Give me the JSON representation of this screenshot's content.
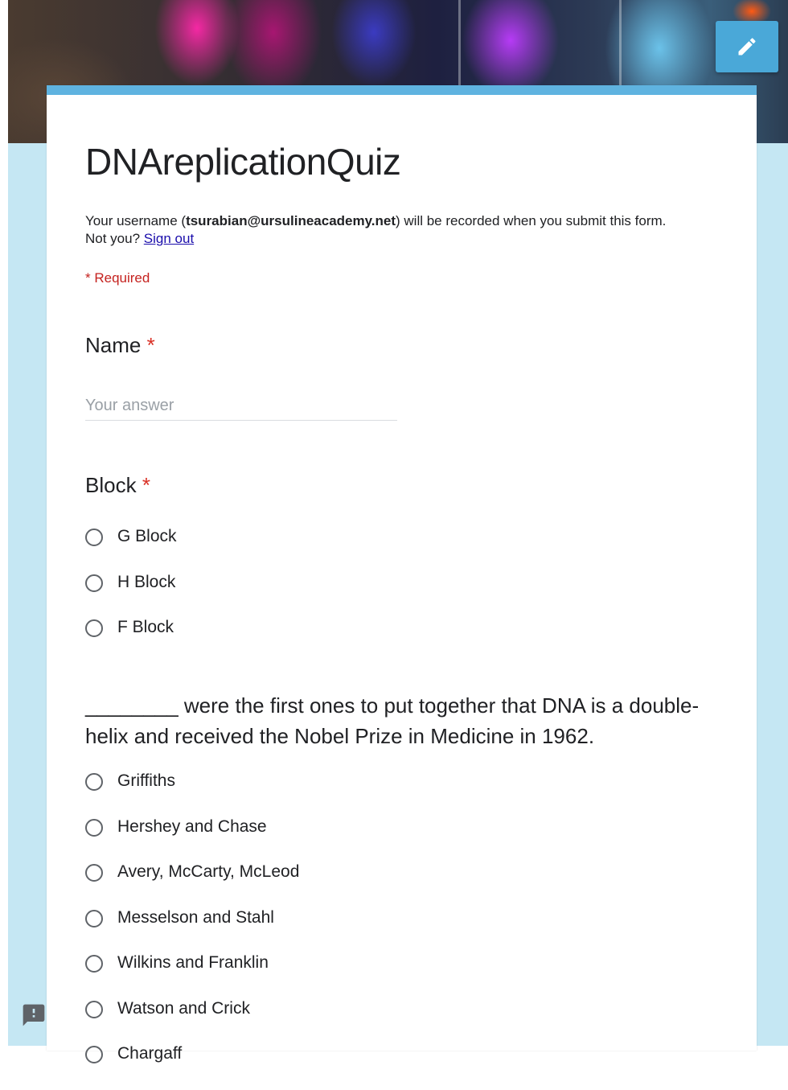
{
  "header": {
    "edit_icon": "pencil-icon",
    "accent_color": "#5fb3e0",
    "background_color": "#c5e7f3"
  },
  "form": {
    "title": "DNAreplicationQuiz",
    "notice": {
      "prefix": "Your username (",
      "email": "tsurabian@ursulineacademy.net",
      "suffix": ") will be recorded when you submit this form.",
      "not_you": "Not you?",
      "sign_out": "Sign out"
    },
    "required_note": "* Required"
  },
  "questions": {
    "name": {
      "title": "Name",
      "required_mark": "*",
      "placeholder": "Your answer",
      "value": ""
    },
    "block": {
      "title": "Block",
      "required_mark": "*",
      "options": [
        "G Block",
        "H Block",
        "F Block"
      ]
    },
    "dna": {
      "title": "________ were the first ones to put together that DNA is a double-helix and received the Nobel Prize in Medicine in 1962.",
      "options": [
        "Griffiths",
        "Hershey and Chase",
        "Avery, McCarty, McLeod",
        "Messelson and Stahl",
        "Wilkins and Franklin",
        "Watson and Crick",
        "Chargaff"
      ]
    }
  },
  "footer": {
    "feedback_icon": "feedback-icon"
  }
}
